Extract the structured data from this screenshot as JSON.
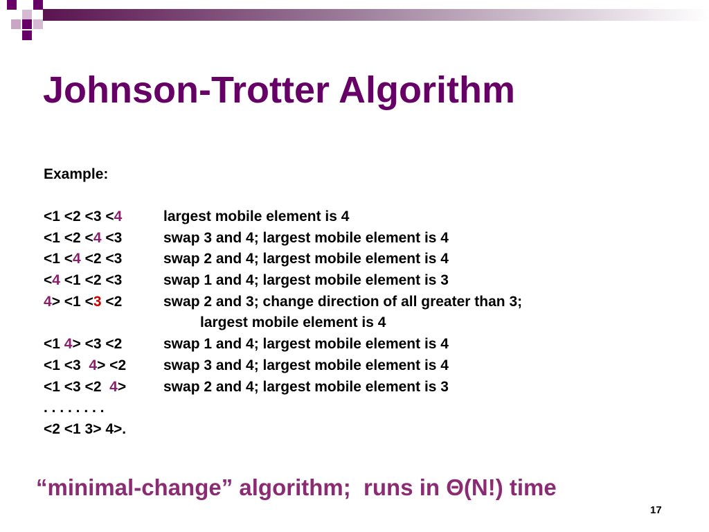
{
  "colors": {
    "title": "#660066",
    "accent": "#8b1f6e",
    "highlight_red": "#cc0000",
    "footer": "#8b2b74"
  },
  "slide": {
    "title": "Johnson-Trotter Algorithm",
    "example_label": "Example:",
    "rows": [
      {
        "perm": [
          {
            "t": "<1 <2 <3 <"
          },
          {
            "t": "4",
            "c": "purple"
          }
        ],
        "desc": "largest mobile element is 4"
      },
      {
        "perm": [
          {
            "t": "<1 <2 <"
          },
          {
            "t": "4",
            "c": "purple"
          },
          {
            "t": " <3"
          }
        ],
        "desc": "swap 3 and 4; largest mobile element is 4"
      },
      {
        "perm": [
          {
            "t": "<1 <"
          },
          {
            "t": "4",
            "c": "purple"
          },
          {
            "t": " <2 <3"
          }
        ],
        "desc": "swap 2 and 4; largest mobile element is 4"
      },
      {
        "perm": [
          {
            "t": "<"
          },
          {
            "t": "4",
            "c": "purple"
          },
          {
            "t": " <1 <2 <3"
          }
        ],
        "desc": "swap 1 and 4; largest mobile element is 3"
      },
      {
        "perm": [
          {
            "t": "4",
            "c": "purple"
          },
          {
            "t": "> <1 <"
          },
          {
            "t": "3",
            "c": "red"
          },
          {
            "t": " <2"
          }
        ],
        "desc": "swap 2 and 3; change direction of all greater than 3;"
      },
      {
        "perm": [],
        "desc": "largest mobile element is 4",
        "continuation": true
      },
      {
        "perm": [
          {
            "t": "<1 "
          },
          {
            "t": "4",
            "c": "purple"
          },
          {
            "t": "> <3 <2"
          }
        ],
        "desc": "swap 1 and 4; largest mobile element is 4"
      },
      {
        "perm": [
          {
            "t": "<1 <3  "
          },
          {
            "t": "4",
            "c": "purple"
          },
          {
            "t": "> <2"
          }
        ],
        "desc": "swap 3 and 4; largest mobile element is 4"
      },
      {
        "perm": [
          {
            "t": "<1 <3 <2  "
          },
          {
            "t": "4",
            "c": "purple"
          },
          {
            "t": ">"
          }
        ],
        "desc": "swap 2 and 4; largest mobile element is 3"
      },
      {
        "perm": [
          {
            "t": ". . . . . . . ."
          }
        ],
        "desc": ""
      },
      {
        "perm": [
          {
            "t": "<2 <1 3> 4>."
          }
        ],
        "desc": ""
      }
    ],
    "footer": "“minimal-change” algorithm;  runs in Θ(N!) time",
    "page_number": "17"
  }
}
